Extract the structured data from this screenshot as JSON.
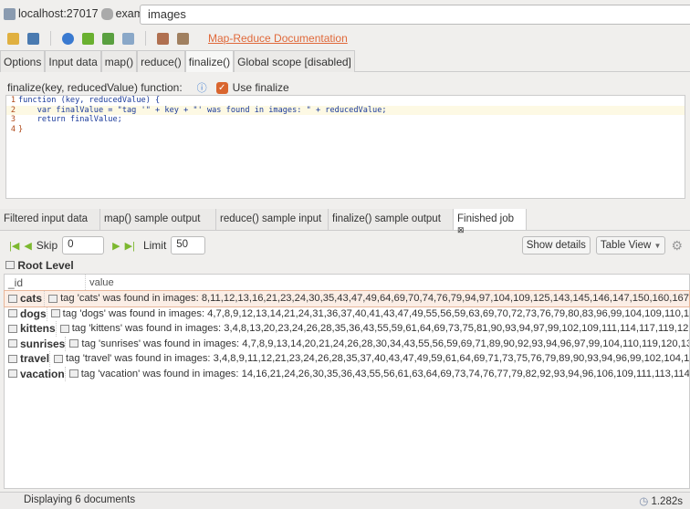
{
  "connection": {
    "host": "localhost:27017",
    "database": "exam",
    "collection": "images"
  },
  "toolbar": {
    "icons": [
      "open-icon",
      "save-icon",
      "run-icon",
      "step-icon",
      "output-icon",
      "clear-icon",
      "paste-icon",
      "copy-icon"
    ],
    "doc_link": "Map-Reduce Documentation"
  },
  "tabs": [
    "Options",
    "Input data",
    "map()",
    "reduce()",
    "finalize()",
    "Global scope [disabled]"
  ],
  "active_tab": "finalize()",
  "finalize": {
    "label": "finalize(key, reducedValue) function:",
    "use_label": "Use finalize",
    "use_checked": true,
    "code": [
      {
        "n": "1",
        "text": "function (key, reducedValue) {"
      },
      {
        "n": "2",
        "text": "    var finalValue = \"tag '\" + key + \"' was found in images: \" + reducedValue;"
      },
      {
        "n": "3",
        "text": "    return finalValue;"
      },
      {
        "n": "4",
        "text": "}"
      }
    ]
  },
  "result_tabs": [
    "Filtered input data",
    "map() sample output",
    "reduce() sample input",
    "finalize() sample output",
    "Finished job"
  ],
  "pager": {
    "skip_label": "Skip",
    "skip": "0",
    "limit_label": "Limit",
    "limit": "50",
    "show_details": "Show details",
    "view": "Table View"
  },
  "root_label": "Root Level",
  "table": {
    "columns": [
      "_id",
      "value"
    ],
    "rows": [
      {
        "id": "cats",
        "value": "tag 'cats' was found in images: 8,11,12,13,16,21,23,24,30,35,43,47,49,64,69,70,74,76,79,94,97,104,109,125,143,145,146,147,150,160,167"
      },
      {
        "id": "dogs",
        "value": "tag 'dogs' was found in images: 4,7,8,9,12,13,14,21,24,31,36,37,40,41,43,47,49,55,56,59,63,69,70,72,73,76,79,80,83,96,99,104,109,110,1"
      },
      {
        "id": "kittens",
        "value": "tag 'kittens' was found in images: 3,4,8,13,20,23,24,26,28,35,36,43,55,59,61,64,69,73,75,81,90,93,94,97,99,102,109,111,114,117,119,125"
      },
      {
        "id": "sunrises",
        "value": "tag 'sunrises' was found in images: 4,7,8,9,13,14,20,21,24,26,28,30,34,43,55,56,59,69,71,89,90,92,93,94,96,97,99,104,110,119,120,132,14"
      },
      {
        "id": "travel",
        "value": "tag 'travel' was found in images: 3,4,8,9,11,12,21,23,24,26,28,35,37,40,43,47,49,59,61,64,69,71,73,75,76,79,89,90,93,94,96,99,102,104,10"
      },
      {
        "id": "vacation",
        "value": "tag 'vacation' was found in images: 14,16,21,24,26,30,35,36,43,55,56,61,63,64,69,73,74,76,77,79,82,92,93,94,96,106,109,111,113,114,11"
      }
    ]
  },
  "status": {
    "text": "Displaying 6 documents",
    "time": "1.282s"
  },
  "colors": {
    "link": "#e0693a",
    "accent": "#d9652e",
    "nav": "#7cb82f"
  }
}
